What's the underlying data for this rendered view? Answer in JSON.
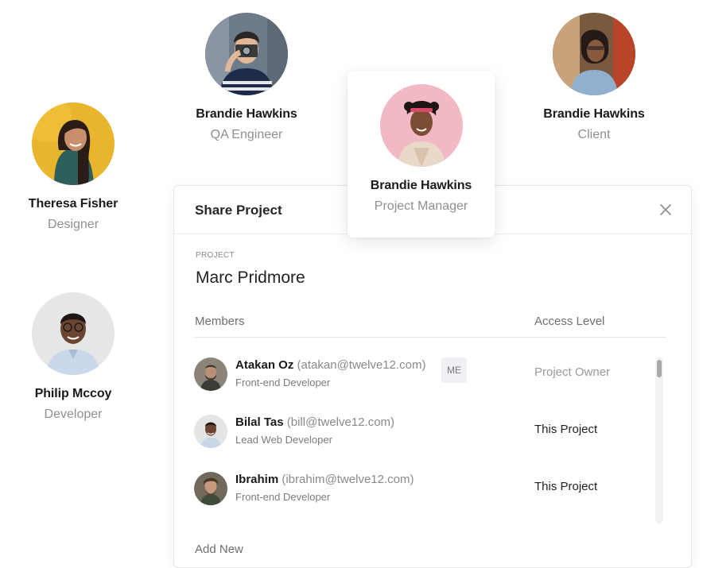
{
  "team": [
    {
      "name": "Theresa Fisher",
      "role": "Designer",
      "avatar": "avatar-theresa"
    },
    {
      "name": "Brandie Hawkins",
      "role": "QA Engineer",
      "avatar": "avatar-qa"
    },
    {
      "name": "Brandie Hawkins",
      "role": "Project Manager",
      "avatar": "avatar-pm"
    },
    {
      "name": "Brandie Hawkins",
      "role": "Client",
      "avatar": "avatar-client"
    },
    {
      "name": "Philip Mccoy",
      "role": "Developer",
      "avatar": "avatar-philip"
    }
  ],
  "modal": {
    "title": "Share Project",
    "close_icon": "close-icon",
    "project_label": "PROJECT",
    "project_name": "Marc Pridmore",
    "members_header": "Members",
    "access_header": "Access Level",
    "members": [
      {
        "name": "Atakan Oz",
        "email": "(atakan@twelve12.com)",
        "role": "Front-end Developer",
        "badge": "ME",
        "access": "Project Owner"
      },
      {
        "name": "Bilal Tas",
        "email": "(bill@twelve12.com)",
        "role": "Lead Web Developer",
        "access": "This Project"
      },
      {
        "name": "Ibrahim",
        "email": "(ibrahim@twelve12.com)",
        "role": "Front-end Developer",
        "access": "This Project"
      }
    ],
    "add_new": "Add New"
  }
}
